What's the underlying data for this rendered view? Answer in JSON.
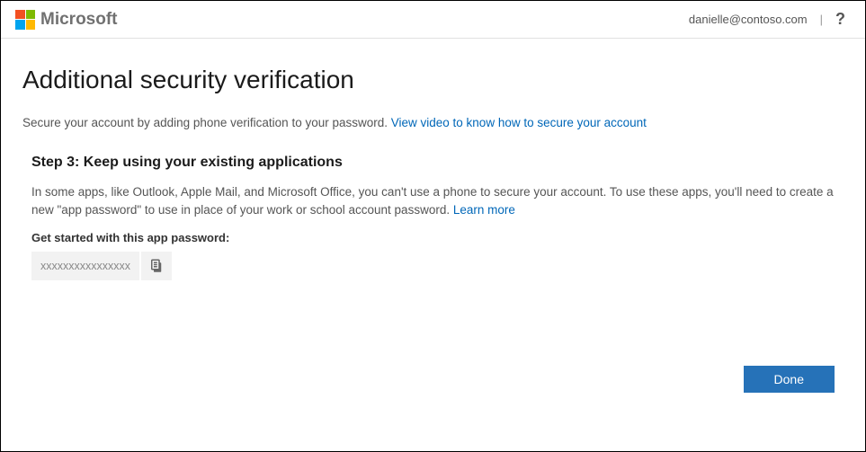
{
  "header": {
    "brand": "Microsoft",
    "user_email": "danielle@contoso.com",
    "divider": "|",
    "help": "?"
  },
  "main": {
    "title": "Additional security verification",
    "intro_text": "Secure your account by adding phone verification to your password. ",
    "intro_link": "View video to know how to secure your account",
    "step_title": "Step 3: Keep using your existing applications",
    "step_desc_a": "In some apps, like Outlook, Apple Mail, and Microsoft Office, you can't use a phone to secure your account. To use these apps, you'll need to create a new \"app password\" to use in place of your work or school account password. ",
    "step_desc_link": "Learn more",
    "sub_label": "Get started with this app password:",
    "password_value": "xxxxxxxxxxxxxxxx",
    "done_label": "Done"
  }
}
